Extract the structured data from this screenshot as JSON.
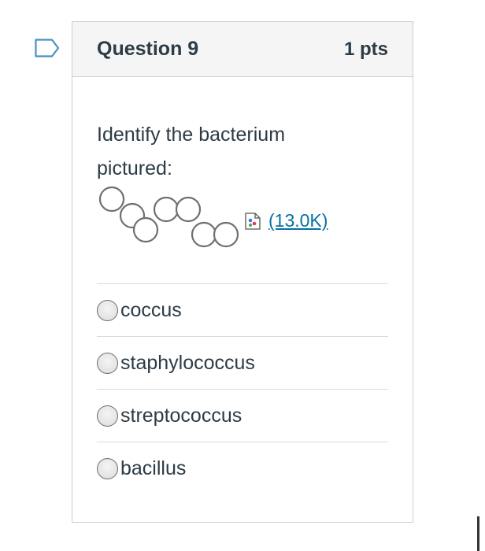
{
  "question": {
    "title": "Question 9",
    "points": "1 pts",
    "prompt": "Identify the bacterium pictured:",
    "attachment_link": "(13.0K)",
    "icons": {
      "flag": "bookmark-flag-icon",
      "attachment": "image-file-icon",
      "figure": "bacteria-chain-figure"
    }
  },
  "answers": [
    {
      "label": "coccus",
      "selected": false
    },
    {
      "label": "staphylococcus",
      "selected": false
    },
    {
      "label": "streptococcus",
      "selected": false
    },
    {
      "label": "bacillus",
      "selected": false
    }
  ],
  "colors": {
    "link": "#0770a3",
    "text": "#2d3b45",
    "flag": "#4a90c2",
    "border": "#c7cdd1",
    "header_bg": "#f5f5f5"
  }
}
